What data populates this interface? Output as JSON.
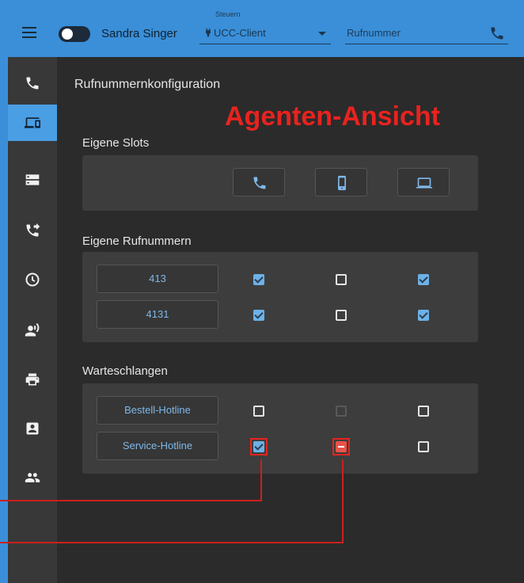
{
  "header": {
    "user_name": "Sandra Singer",
    "steuern_label": "Steuern",
    "client_select_value": "UCC-Client",
    "phone_placeholder": "Rufnummer",
    "accent_color": "#3a8fd8"
  },
  "sidebar": {
    "items": [
      {
        "icon": "phone-icon",
        "active": false
      },
      {
        "icon": "devices-icon",
        "active": true
      },
      {
        "icon": "server-icon",
        "active": false
      },
      {
        "icon": "call-forward-icon",
        "active": false
      },
      {
        "icon": "clock-icon",
        "active": false
      },
      {
        "icon": "voice-user-icon",
        "active": false
      },
      {
        "icon": "printer-icon",
        "active": false
      },
      {
        "icon": "contact-card-icon",
        "active": false
      },
      {
        "icon": "group-icon",
        "active": false
      }
    ]
  },
  "main": {
    "page_title": "Rufnummernkonfiguration",
    "overlay_label": "Agenten-Ansicht",
    "slots_title": "Eigene Slots",
    "slots": [
      "phone-icon",
      "mobile-icon",
      "laptop-icon"
    ],
    "numbers_title": "Eigene Rufnummern",
    "numbers": [
      {
        "label": "413",
        "states": [
          "checked",
          "unchecked",
          "checked"
        ]
      },
      {
        "label": "4131",
        "states": [
          "checked",
          "unchecked",
          "checked"
        ]
      }
    ],
    "queues_title": "Warteschlangen",
    "queues": [
      {
        "label": "Bestell-Hotline",
        "states": [
          "unchecked",
          "disabled",
          "unchecked"
        ]
      },
      {
        "label": "Service-Hotline",
        "states": [
          "checked",
          "indeterminate",
          "unchecked"
        ]
      }
    ]
  }
}
